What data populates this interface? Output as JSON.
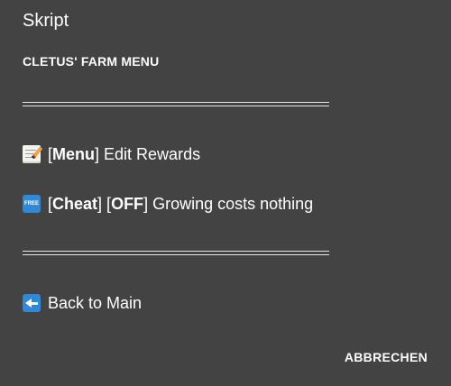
{
  "dialog": {
    "title": "Skript",
    "subtitle": "CLETUS' FARM MENU"
  },
  "items": [
    {
      "icon": "memo-icon",
      "bracket_open": "[",
      "tag": "Menu",
      "bracket_close": "]",
      "label": " Edit Rewards"
    },
    {
      "icon": "free-icon",
      "icon_text": "FREE",
      "bracket_open": "[",
      "tag": "Cheat",
      "bracket_close": "]",
      "state_open": " [",
      "state": "OFF",
      "state_close": "]",
      "label": " Growing costs nothing"
    },
    {
      "icon": "back-arrow-icon",
      "label": "Back to Main"
    }
  ],
  "footer": {
    "cancel_label": "ABBRECHEN"
  },
  "colors": {
    "background": "#434343",
    "text": "#ffffff",
    "icon_blue": "#2f89d6"
  }
}
